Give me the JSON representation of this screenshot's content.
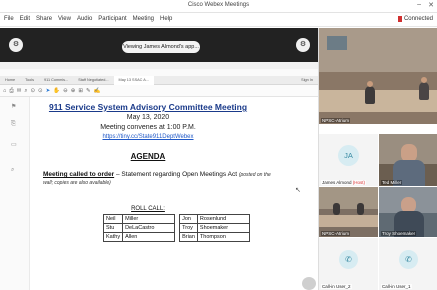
{
  "window": {
    "title": "Cisco Webex Meetings",
    "minimize_icon": "minimize-icon",
    "close_icon": "close-icon"
  },
  "menubar": {
    "items": [
      "File",
      "Edit",
      "Share",
      "View",
      "Audio",
      "Participant",
      "Meeting",
      "Help"
    ],
    "status": "Connected"
  },
  "share_bar": {
    "label": "Viewing James Almond's app..."
  },
  "pdf_viewer": {
    "tabs": [
      "Home",
      "Tools",
      "911 Commis...",
      "Staff Negotiated...",
      "May 13 SSAC A..."
    ],
    "active_tab": 4,
    "sign_in": "Sign In"
  },
  "document": {
    "title": "911 Service System Advisory Committee Meeting",
    "date": "May 13, 2020",
    "convenes": "Meeting convenes at 1:00 P.M.",
    "link": "https://tiny.cc/State911DeptWebex",
    "agenda": "AGENDA",
    "call_to_order_heading": "Meeting called to order",
    "call_to_order_text": " – Statement regarding Open Meetings Act ",
    "call_to_order_note": "(posted on the wall; copies are also available)",
    "roll_call_heading": "ROLL CALL:",
    "roll_call": [
      [
        "Neil",
        "Miller",
        "Jon",
        "Rosenlund"
      ],
      [
        "Stu",
        "DeLaCastro",
        "Troy",
        "Shoemaker"
      ],
      [
        "Kathy",
        "Allen",
        "Brian",
        "Thompson"
      ]
    ]
  },
  "participants": [
    {
      "name": "NPSC-Atrium",
      "kind": "video"
    },
    {
      "name": "James Almond",
      "initials": "JA",
      "status": "(Host)",
      "kind": "avatar"
    },
    {
      "name": "Ted Miller",
      "kind": "video"
    },
    {
      "name": "NPSC-Atrium",
      "kind": "video"
    },
    {
      "name": "Troy Shoemaker",
      "kind": "video"
    },
    {
      "name": "Call-in User_2",
      "kind": "phone"
    },
    {
      "name": "Call-in User_1",
      "kind": "phone"
    }
  ]
}
